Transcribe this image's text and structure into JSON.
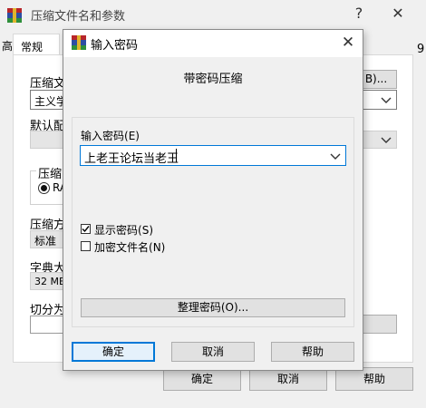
{
  "bg_dialog": {
    "title": "压缩文件名和参数",
    "help_icon": "?",
    "close_icon": "✕",
    "tab_general": "常规",
    "tab_partial_left": "高",
    "label_archive_name": "压缩文",
    "archive_name_value": "主义学",
    "browse_label": "B)...",
    "label_default_profile": "默认配",
    "group_archive_format": "压缩",
    "radio_rar": "RA",
    "label_compression_method": "压缩方",
    "compression_method_value": "标准",
    "label_dictionary": "字典大",
    "dictionary_value": "32 MB",
    "label_split": "切分为",
    "right_edge_char": "9",
    "ok_label": "确定",
    "cancel_label": "取消",
    "help_label": "帮助"
  },
  "pwd_dialog": {
    "title": "输入密码",
    "heading": "带密码压缩",
    "label_enter_password": "输入密码",
    "label_enter_password_key": "(E)",
    "password_value": "上老王论坛当老王",
    "show_password_label": "显示密码",
    "show_password_key": "(S)",
    "show_password_checked": true,
    "encrypt_filenames_label": "加密文件名",
    "encrypt_filenames_key": "(N)",
    "encrypt_filenames_checked": false,
    "organize_label": "整理密码",
    "organize_key": "(O)...",
    "ok_label": "确定",
    "cancel_label": "取消",
    "help_label": "帮助",
    "close_icon": "✕"
  },
  "colors": {
    "accent": "#0078d7",
    "window_bg": "#f0f0f0",
    "logo_red": "#b8262a",
    "logo_blue": "#2d4da3",
    "logo_green": "#2f8f3b",
    "logo_gold": "#e0b42c"
  }
}
